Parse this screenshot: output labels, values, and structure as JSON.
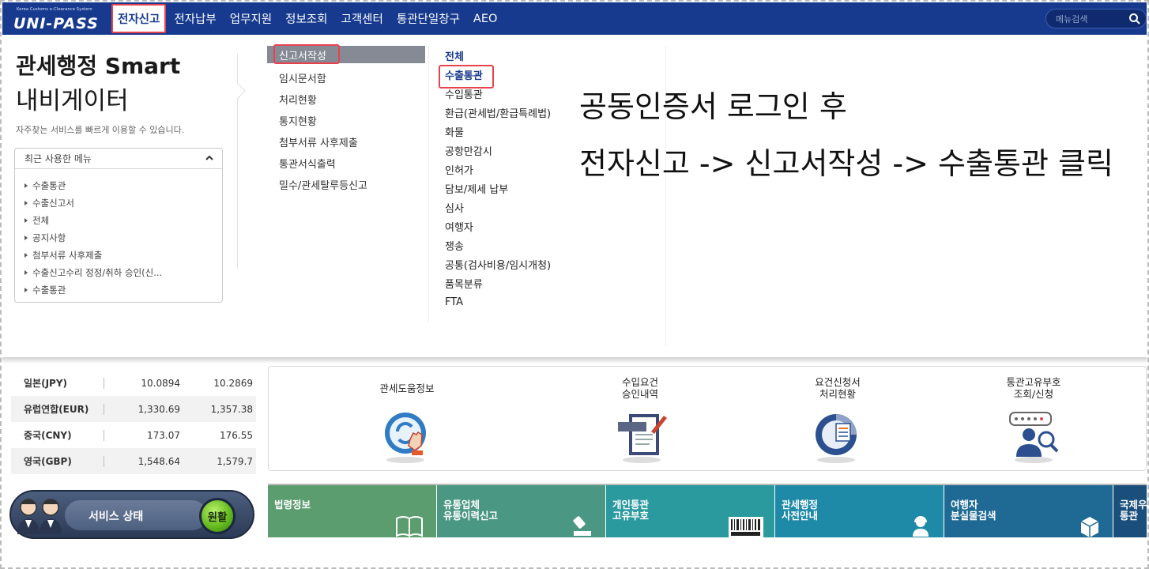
{
  "logo": {
    "sub": "Korea Customs e-Clearance System",
    "main": "UNI-PASS"
  },
  "nav": [
    "전자신고",
    "전자납부",
    "업무지원",
    "정보조회",
    "고객센터",
    "통관단일창구",
    "AEO"
  ],
  "search": {
    "placeholder": "메뉴검색"
  },
  "navigator": {
    "title1": "관세행정 Smart",
    "title2": "내비게이터",
    "desc": "자주찾는 서비스를 빠르게 이용할 수 있습니다.",
    "recent_title": "최근 사용한 메뉴",
    "recent": [
      "수출통관",
      "수출신고서",
      "전체",
      "공지사항",
      "첨부서류 사후제출",
      "수출신고수리 정정/취하 승인(신...",
      "수출통관"
    ]
  },
  "sub_menu": [
    "신고서작성",
    "임시문서함",
    "처리현황",
    "통지현황",
    "첨부서류 사후제출",
    "통관서식출력",
    "밀수/관세탈루등신고"
  ],
  "leaf_menu": [
    "전체",
    "수출통관",
    "수입통관",
    "환급(관세법/환급특례법)",
    "화물",
    "공항만감시",
    "인허가",
    "담보/제세 납부",
    "심사",
    "여행자",
    "쟁송",
    "공통(검사비용/임시개청)",
    "품목분류",
    "FTA"
  ],
  "annotation": {
    "line1": "공동인증서 로그인 후",
    "line2": "전자신고 -> 신고서작성 -> 수출통관 클릭"
  },
  "fx": [
    {
      "name": "일본(JPY)",
      "v1": "10.0894",
      "v2": "10.2869"
    },
    {
      "name": "유럽연합(EUR)",
      "v1": "1,330.69",
      "v2": "1,357.38"
    },
    {
      "name": "중국(CNY)",
      "v1": "173.07",
      "v2": "176.55"
    },
    {
      "name": "영국(GBP)",
      "v1": "1,548.64",
      "v2": "1,579.7"
    }
  ],
  "services": [
    {
      "label": "관세도움정보",
      "icon": "touch-hand-icon"
    },
    {
      "label": "수입요건\n승인내역",
      "icon": "import-document-icon"
    },
    {
      "label": "요건신청서\n처리현황",
      "icon": "percent-report-icon"
    },
    {
      "label": "통관고유부호\n조회/신청",
      "icon": "person-search-icon"
    }
  ],
  "status": {
    "label": "서비스 상태",
    "value": "원활"
  },
  "tiles": [
    {
      "label": "법령정보",
      "color": "#5c9d70"
    },
    {
      "label": "유통업체\n유통이력신고",
      "color": "#4a9783"
    },
    {
      "label": "개인통관\n고유부호",
      "color": "#2a9a9f"
    },
    {
      "label": "관세행정\n사전안내",
      "color": "#1f8aa7"
    },
    {
      "label": "여행자\n분실물검색",
      "color": "#1f6a94"
    },
    {
      "label": "국제우편\n통관",
      "color": "#1a4f7c"
    }
  ],
  "colors": {
    "header": "#173a8e",
    "highlight": "#e8424f"
  }
}
